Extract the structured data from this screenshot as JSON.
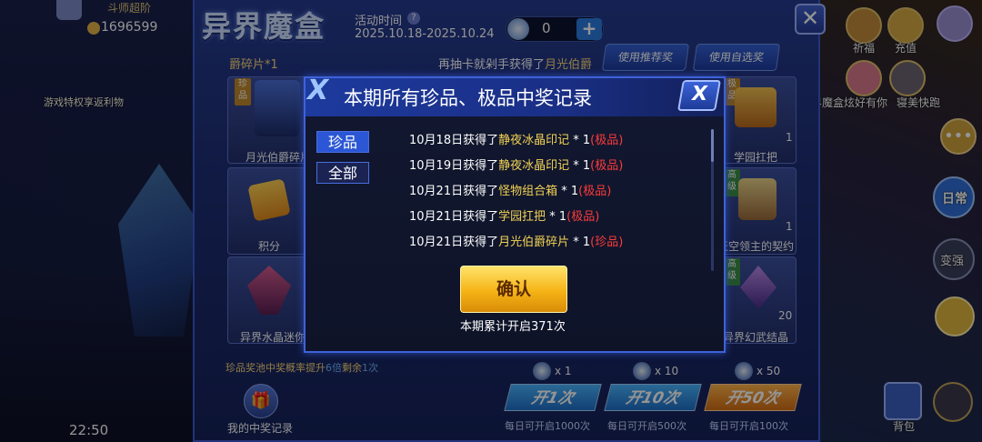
{
  "top_left": {
    "rank_text": "斗师超阶",
    "score": "1696599",
    "banner_text": "游戏特权享返利物",
    "clock": "22:50"
  },
  "panel": {
    "title": "异界魔盒",
    "activity_label": "活动时间",
    "activity_dates": "2025.10.18-2025.10.24",
    "coin_count": "0",
    "plus_label": "+",
    "close_label": "✕",
    "pool_buttons": [
      "使用推荐奖池",
      "使用自选奖池"
    ],
    "fragment_label": "爵碎片*1",
    "ticker": {
      "pre": "再抽卡就剁手获得了",
      "item": "月光伯爵"
    },
    "cards": [
      {
        "name": "月光伯爵碎片",
        "tag": "珍品",
        "count": ""
      },
      {
        "name": "学园扛把",
        "tag": "极品",
        "count": "1"
      },
      {
        "name": "积分",
        "tag": "",
        "count": ""
      },
      {
        "name": "天空领主的契约",
        "tag": "高级",
        "count": "1"
      },
      {
        "name": "异界水晶迷你储",
        "tag": "",
        "count": ""
      },
      {
        "name": "异界幻武结晶",
        "tag": "高级",
        "count": "20"
      }
    ],
    "bonus": {
      "pre": "珍品奖池",
      "mid": "中奖概率提升",
      "mult": "6倍",
      "rest": "剩余",
      "left": "1次"
    },
    "multipliers": [
      "x 1",
      "x 10",
      "x 50"
    ],
    "open_buttons": [
      {
        "label": "开1次",
        "sub": "每日可开启1000次"
      },
      {
        "label": "开10次",
        "sub": "每日可开启500次"
      },
      {
        "label": "开50次",
        "sub": "每日可开启100次"
      }
    ],
    "my_records_label": "我的中奖记录"
  },
  "side_right": {
    "labels": [
      "祈福",
      "充值",
      "界魔盒",
      "炫好有你",
      "寝美快跑",
      "日常",
      "变强",
      "背包"
    ]
  },
  "modal": {
    "title": "本期所有珍品、极品中奖记录",
    "close_label": "X",
    "tabs": [
      "珍品",
      "全部"
    ],
    "records": [
      {
        "date": "10月18日",
        "verb": "获得了",
        "item": "静夜冰晶印记",
        "qty": " * 1",
        "grade": "(极品)"
      },
      {
        "date": "10月19日",
        "verb": "获得了",
        "item": "静夜冰晶印记",
        "qty": " * 1",
        "grade": "(极品)"
      },
      {
        "date": "10月21日",
        "verb": "获得了",
        "item": "怪物组合箱",
        "qty": " * 1",
        "grade": "(极品)"
      },
      {
        "date": "10月21日",
        "verb": "获得了",
        "item": "学园扛把",
        "qty": " * 1",
        "grade": "(极品)"
      },
      {
        "date": "10月21日",
        "verb": "获得了",
        "item": "月光伯爵碎片",
        "qty": " * 1",
        "grade": "(珍品)"
      }
    ],
    "confirm_label": "确认",
    "total_text": "本期累计开启371次"
  },
  "colors": {
    "panel_blue": "#1d2e74",
    "accent_gold": "#f2d255",
    "grade_red": "#ff3b3b",
    "confirm_yellow": "#f5b316"
  }
}
